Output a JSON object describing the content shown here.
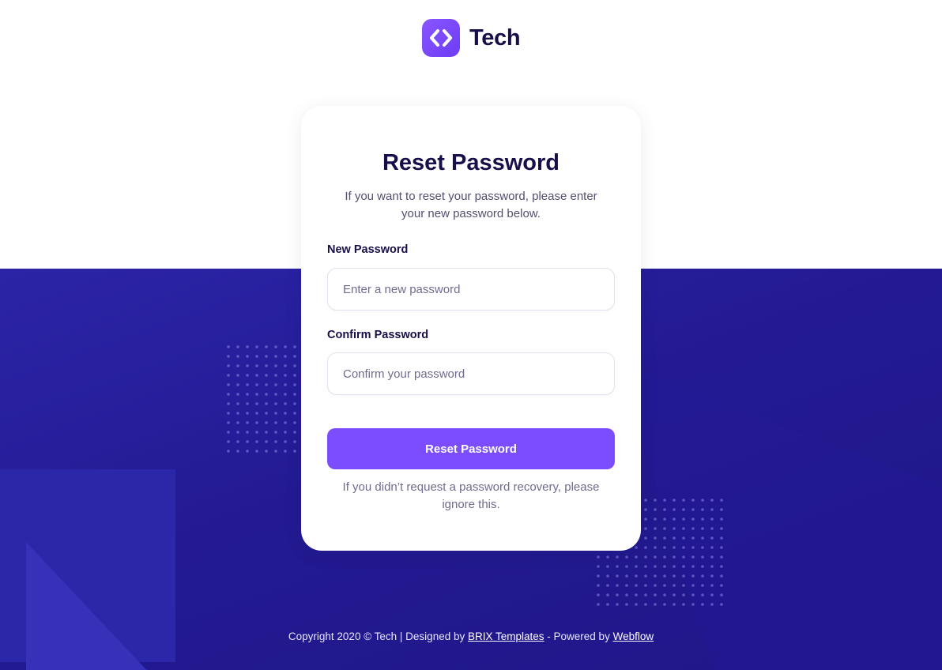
{
  "brand": {
    "name": "Tech",
    "icon": "code-brackets-icon",
    "colors": {
      "primary": "#7c4dff",
      "navy": "#170f49",
      "background_dark": "#231a93"
    }
  },
  "card": {
    "title": "Reset Password",
    "subtitle": "If you want to reset your password, please enter your new password below.",
    "fields": [
      {
        "label": "New Password",
        "placeholder": "Enter a new password",
        "value": ""
      },
      {
        "label": "Confirm Password",
        "placeholder": "Confirm your password",
        "value": ""
      }
    ],
    "submit_label": "Reset Password",
    "note": "If you didn’t request a password recovery, please ignore this."
  },
  "footer": {
    "prefix": "Copyright 2020 © Tech | Designed by ",
    "designer_link": "BRIX Templates",
    "middle": " - Powered by ",
    "platform_link": "Webflow"
  }
}
